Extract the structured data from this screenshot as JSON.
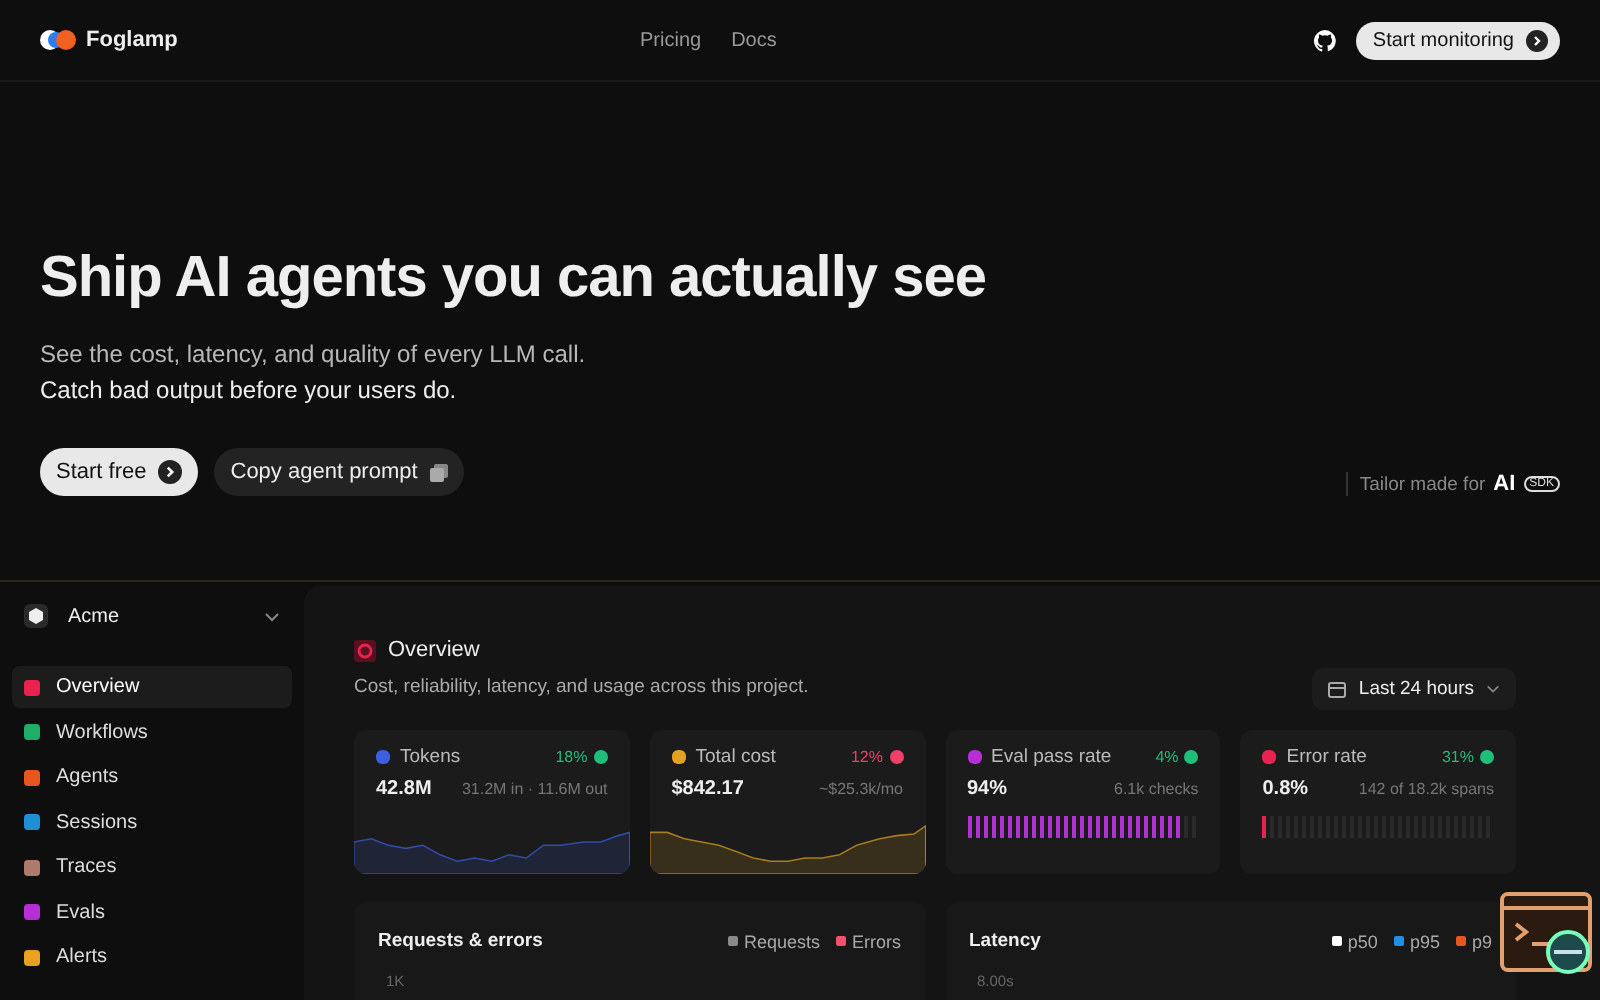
{
  "brand": "Foglamp",
  "nav": [
    "Pricing",
    "Docs"
  ],
  "cta": "Start monitoring",
  "hero": {
    "title": "Ship AI agents you can actually see",
    "lines": [
      "See the cost, latency, and quality of every LLM call.",
      "Catch bad output before your users do."
    ],
    "primary": "Start free",
    "secondary": "Copy agent prompt",
    "tailor": "Tailor made for",
    "tailor_mark": "AI",
    "tailor_badge": "SDK"
  },
  "workspace": "Acme",
  "sidebar": [
    {
      "label": "Overview",
      "color": "#e8234f",
      "selected": true
    },
    {
      "label": "Workflows",
      "color": "#1fae6a",
      "selected": false
    },
    {
      "label": "Agents",
      "color": "#e8561f",
      "selected": false
    },
    {
      "label": "Sessions",
      "color": "#1f8fd6",
      "selected": false
    },
    {
      "label": "Traces",
      "color": "#b07a6a",
      "selected": false
    },
    {
      "label": "Evals",
      "color": "#b62fd6",
      "selected": false
    },
    {
      "label": "Alerts",
      "color": "#e8a21f",
      "selected": false
    }
  ],
  "overview": {
    "title": "Overview",
    "subtitle": "Cost, reliability, latency, and usage across this project.",
    "range": "Last 24 hours"
  },
  "metrics": [
    {
      "label": "Tokens",
      "color": "#3b5fe0",
      "change": "18%",
      "good": true,
      "value": "42.8M",
      "detail": "31.2M in · 11.6M out",
      "kind": "sparkline"
    },
    {
      "label": "Total cost",
      "color": "#e0a21f",
      "change": "12%",
      "good": false,
      "value": "$842.17",
      "detail": "~$25.3k/mo",
      "kind": "sparkline"
    },
    {
      "label": "Eval pass rate",
      "color": "#b62fd6",
      "change": "4%",
      "good": true,
      "value": "94%",
      "detail": "6.1k checks",
      "kind": "bars",
      "level": 0.94
    },
    {
      "label": "Error rate",
      "color": "#e8234f",
      "change": "31%",
      "good": true,
      "value": "0.8%",
      "detail": "142 of 18.2k spans",
      "kind": "bars",
      "level": 0.03
    }
  ],
  "panels": [
    {
      "title": "Requests & errors",
      "legend": [
        {
          "label": "Requests",
          "color": "#8a8a8a"
        },
        {
          "label": "Errors",
          "color": "#f0506a"
        }
      ],
      "tick": "1K"
    },
    {
      "title": "Latency",
      "legend": [
        {
          "label": "p50",
          "color": "#ffffff"
        },
        {
          "label": "p95",
          "color": "#1f8fe6"
        },
        {
          "label": "p9",
          "color": "#e8561f"
        }
      ],
      "tick": "8.00s"
    }
  ]
}
